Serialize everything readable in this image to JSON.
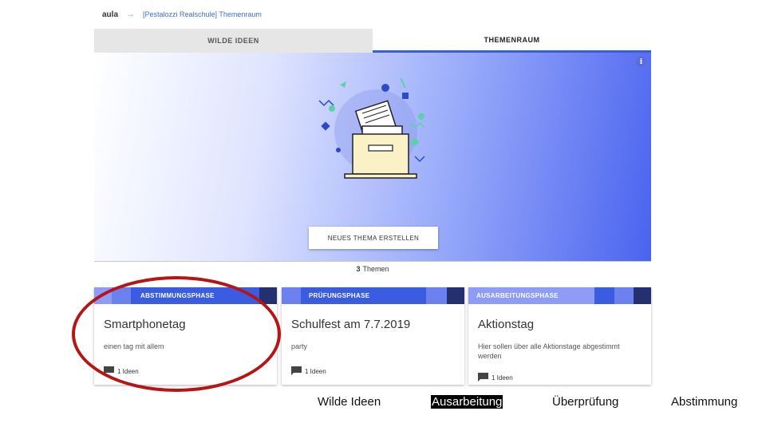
{
  "topbar": {
    "brand": "aula",
    "arrow": "→",
    "breadcrumb": "[Pestalozzi Realschule] Themenraum"
  },
  "tabs": [
    {
      "label": "WILDE IDEEN",
      "active": false
    },
    {
      "label": "THEMENRAUM",
      "active": true
    }
  ],
  "hero": {
    "info_icon": "i",
    "new_topic_button": "NEUES THEMA ERSTELLEN"
  },
  "topic_count": {
    "number": "3",
    "label": "Themen"
  },
  "cards": [
    {
      "phase": "ABSTIMMUNGSPHASE",
      "title": "Smartphonetag",
      "description": "einen tag mit allem",
      "ideas": "1 Ideen"
    },
    {
      "phase": "PRÜFUNGSPHASE",
      "title": "Schulfest am 7.7.2019",
      "description": "party",
      "ideas": "1 Ideen"
    },
    {
      "phase": "AUSARBEITUNGSPHASE",
      "title": "Aktionstag",
      "description": "Hier sollen über alle Aktionstage abgestimmt werden",
      "ideas": "1 Ideen"
    }
  ],
  "legend": {
    "wilde_ideen": "Wilde  Ideen",
    "ausarbeitung": "Ausarbeitung",
    "ueberpruefung": "Überprüfung",
    "abstimmung": "Abstimmung"
  },
  "colors": {
    "accent": "#3a5ce0",
    "annotation": "#b51515",
    "phase_dark": "#24306f",
    "phase_blue": "#3a5ce0",
    "phase_light": "#8e9cf5"
  },
  "icons": [
    "info-icon",
    "comment-icon",
    "file-cabinet-illustration"
  ]
}
